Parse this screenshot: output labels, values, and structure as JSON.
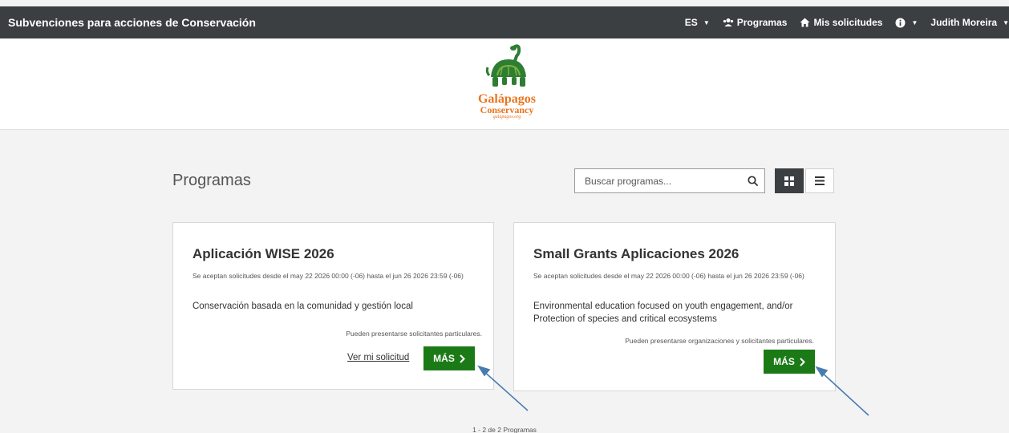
{
  "navbar": {
    "title": "Subvenciones para acciones de Conservación",
    "language": "ES",
    "programs": "Programas",
    "my_applications": "Mis solicitudes",
    "user": "Judith Moreira"
  },
  "logo": {
    "line1": "Galápagos",
    "line2": "Conservancy",
    "line3": "galapagos.org"
  },
  "main": {
    "title": "Programas",
    "search_placeholder": "Buscar programas...",
    "pagination": "1 - 2 de 2 Programas"
  },
  "cards": [
    {
      "title": "Aplicación WISE 2026",
      "dates": "Se aceptan solicitudes desde el may 22 2026 00:00 (-06) hasta el jun 26 2026 23:59 (-06)",
      "description": "Conservación basada en la comunidad y gestión local",
      "eligibility": "Pueden presentarse solicitantes particulares.",
      "view_link": "Ver mi solicitud",
      "more": "MÁS"
    },
    {
      "title": "Small Grants Aplicaciones 2026",
      "dates": "Se aceptan solicitudes desde el may 22 2026 00:00 (-06) hasta el jun 26 2026 23:59 (-06)",
      "description": "Environmental education focused on youth engagement, and/or Protection of species and critical ecosystems",
      "eligibility": "Pueden presentarse organizaciones y solicitantes particulares.",
      "more": "MÁS"
    }
  ],
  "colors": {
    "navbar": "#3b3f42",
    "accent_green": "#1b7a16",
    "logo_orange": "#e8741e",
    "annotation_arrow": "#4a7bb0"
  }
}
